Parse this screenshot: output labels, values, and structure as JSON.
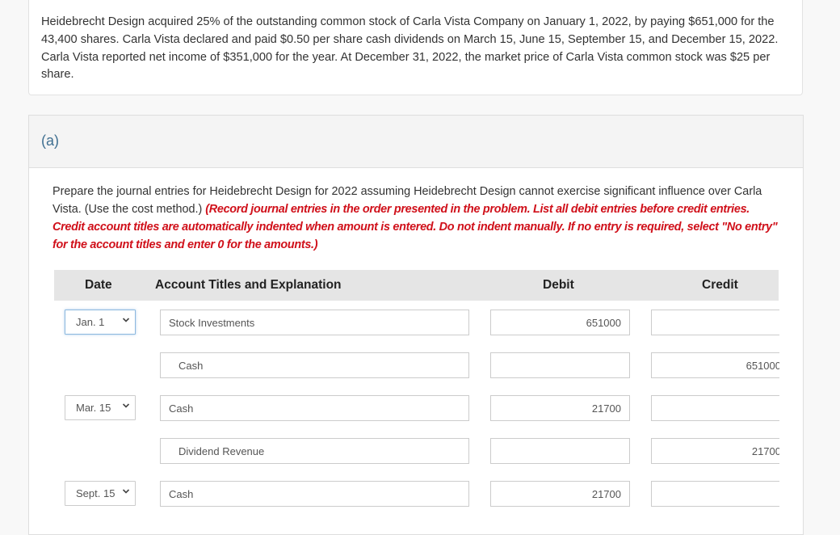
{
  "problem": {
    "text": "Heidebrecht Design acquired 25% of the outstanding common stock of Carla Vista Company on January 1, 2022, by paying $651,000 for the 43,400 shares. Carla Vista declared and paid $0.50 per share cash dividends on March 15, June 15, September 15, and December 15, 2022. Carla Vista reported net income of $351,000 for the year. At December 31, 2022, the market price of Carla Vista common stock was $25 per share."
  },
  "part": {
    "label": "(a)",
    "instructions_plain": "Prepare the journal entries for Heidebrecht Design for 2022 assuming Heidebrecht Design cannot exercise significant influence over Carla Vista. (Use the cost method.) ",
    "instructions_red": "(Record journal entries in the order presented in the problem. List all debit entries before credit entries. Credit account titles are automatically indented when amount is entered. Do not indent manually. If no entry is required, select \"No entry\" for the account titles and enter 0 for the amounts.)"
  },
  "table": {
    "headers": {
      "date": "Date",
      "account": "Account Titles and Explanation",
      "debit": "Debit",
      "credit": "Credit"
    },
    "rows": [
      {
        "date": "Jan. 1",
        "account": "Stock Investments",
        "debit": "651000",
        "credit": ""
      },
      {
        "date": "",
        "account": "Cash",
        "debit": "",
        "credit": "651000"
      },
      {
        "date": "Mar. 15",
        "account": "Cash",
        "debit": "21700",
        "credit": ""
      },
      {
        "date": "",
        "account": "Dividend Revenue",
        "debit": "",
        "credit": "21700"
      },
      {
        "date": "Sept. 15",
        "account": "Cash",
        "debit": "21700",
        "credit": ""
      }
    ]
  },
  "icons": {
    "date_dropdown": "chevron-down-icon"
  }
}
